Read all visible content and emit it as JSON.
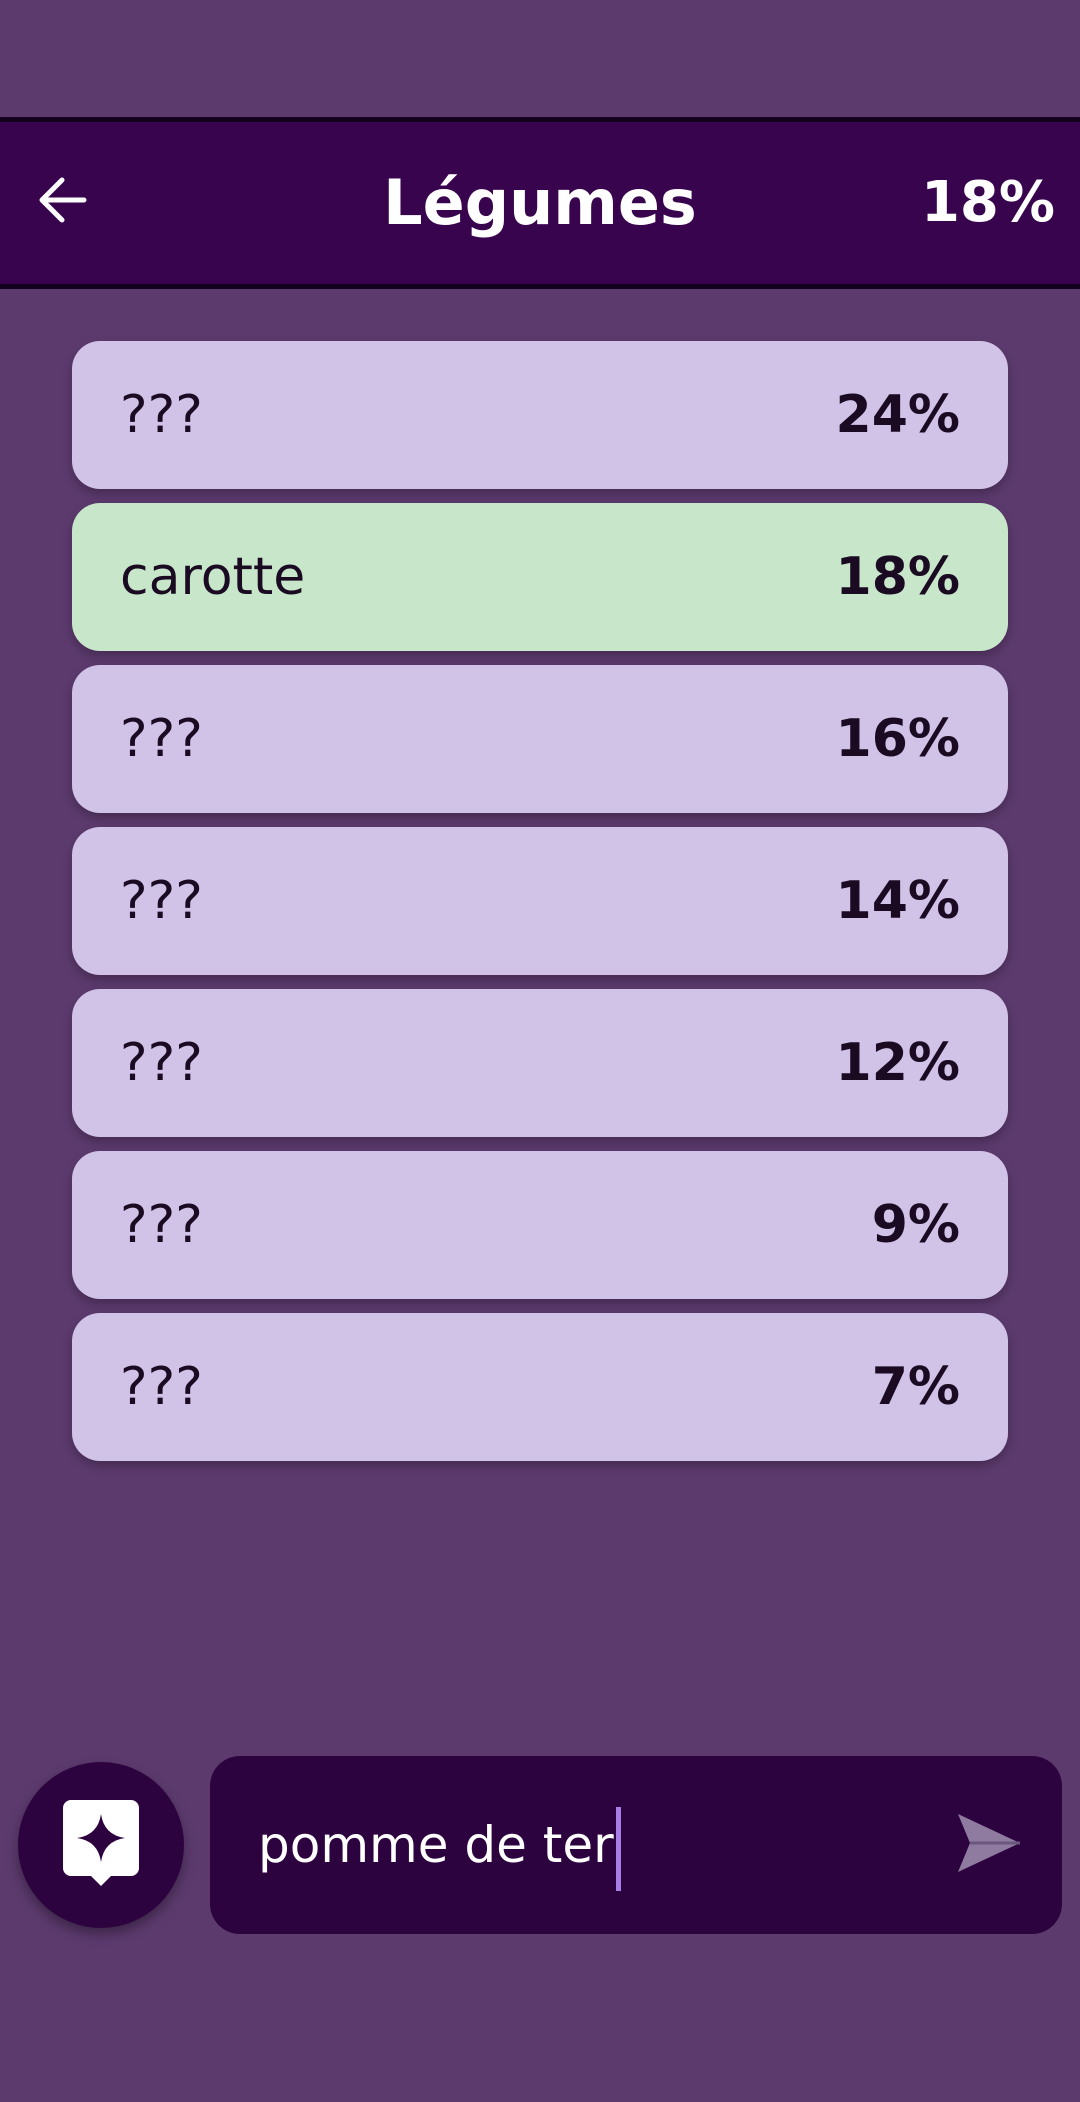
{
  "header": {
    "title": "Légumes",
    "score": "18%"
  },
  "answers": [
    {
      "word": "???",
      "percent": "24%",
      "found": false
    },
    {
      "word": "carotte",
      "percent": "18%",
      "found": true
    },
    {
      "word": "???",
      "percent": "16%",
      "found": false
    },
    {
      "word": "???",
      "percent": "14%",
      "found": false
    },
    {
      "word": "???",
      "percent": "12%",
      "found": false
    },
    {
      "word": "???",
      "percent": "9%",
      "found": false
    },
    {
      "word": "???",
      "percent": "7%",
      "found": false
    }
  ],
  "input": {
    "value": "pomme de ter"
  },
  "icons": {
    "back": "arrow-left-icon",
    "hint": "sparkle-hint-icon",
    "send": "send-icon"
  },
  "colors": {
    "background": "#5c3a6e",
    "header": "#38044e",
    "row": "#d1c3e8",
    "row_found": "#c8e6c9",
    "input": "#2d033f",
    "caret": "#a77fe6"
  }
}
